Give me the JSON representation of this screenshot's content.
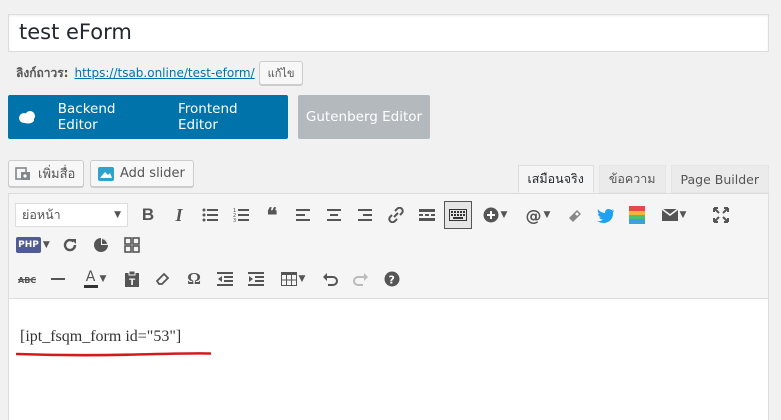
{
  "title": "test eForm",
  "permalink": {
    "label": "ลิงก์ถาวร:",
    "url": "https://tsab.online/test-eform/",
    "edit": "แก้ไข"
  },
  "builder": {
    "backend": "Backend Editor",
    "frontend": "Frontend Editor",
    "gutenberg": "Gutenberg Editor"
  },
  "media": {
    "add_media": "เพิ่มสื่อ",
    "add_slider": "Add slider"
  },
  "tabs": [
    "เสมือนจริง",
    "ข้อความ",
    "Page Builder"
  ],
  "toolbar": {
    "format_select": "ย่อหน้า",
    "php_badge": "PHP"
  },
  "content": {
    "shortcode": "[ipt_fsqm_form id=\"53\"]"
  },
  "colors": {
    "primary": "#0073aa",
    "annotation": "#d21c1c"
  }
}
